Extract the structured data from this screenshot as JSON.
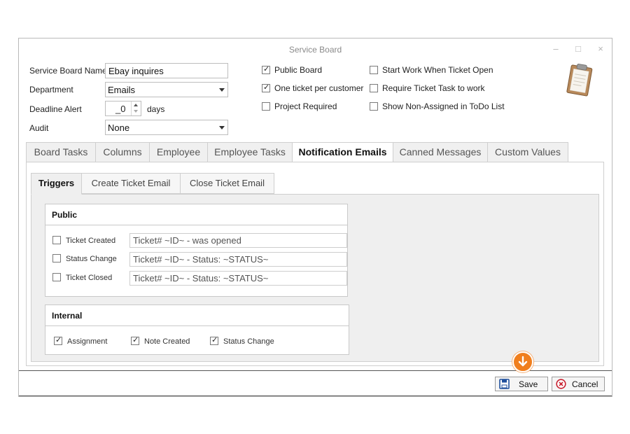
{
  "window": {
    "title": "Service Board"
  },
  "form": {
    "name_label": "Service Board Name",
    "name_value": "Ebay inquires",
    "department_label": "Department",
    "department_value": "Emails",
    "deadline_label": "Deadline Alert",
    "deadline_value": "_0",
    "deadline_unit": "days",
    "audit_label": "Audit",
    "audit_value": "None"
  },
  "options": [
    {
      "label": "Public Board",
      "checked": true
    },
    {
      "label": "One ticket per customer",
      "checked": true
    },
    {
      "label": "Project Required",
      "checked": false
    },
    {
      "label": "Start Work When Ticket Open",
      "checked": false
    },
    {
      "label": "Require Ticket Task to work",
      "checked": false
    },
    {
      "label": "Show Non-Assigned in ToDo List",
      "checked": false
    }
  ],
  "tabs": [
    "Board Tasks",
    "Columns",
    "Employee",
    "Employee Tasks",
    "Notification Emails",
    "Canned Messages",
    "Custom Values"
  ],
  "active_tab": "Notification Emails",
  "subtabs": [
    "Triggers",
    "Create Ticket Email",
    "Close Ticket Email"
  ],
  "active_subtab": "Triggers",
  "public": {
    "title": "Public",
    "rows": [
      {
        "label": "Ticket Created",
        "checked": false,
        "template": "Ticket#  ~ID~ - was opened"
      },
      {
        "label": "Status Change",
        "checked": false,
        "template": "Ticket#  ~ID~ - Status:  ~STATUS~"
      },
      {
        "label": "Ticket Closed",
        "checked": false,
        "template": "Ticket#  ~ID~ - Status:  ~STATUS~"
      }
    ]
  },
  "internal": {
    "title": "Internal",
    "items": [
      {
        "label": "Assignment",
        "checked": true
      },
      {
        "label": "Note Created",
        "checked": true
      },
      {
        "label": "Status Change",
        "checked": true
      }
    ]
  },
  "footer": {
    "save_label": "Save",
    "cancel_label": "Cancel"
  },
  "colors": {
    "accent_orange": "#f07f1e",
    "save_icon": "#1f4f9c",
    "cancel_icon": "#c8202f"
  }
}
